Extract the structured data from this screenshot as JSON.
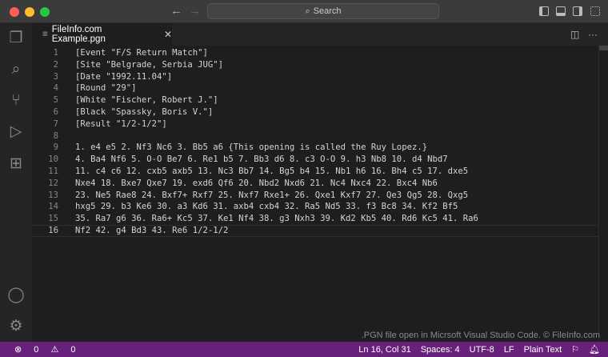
{
  "titlebar": {
    "search_label": "Search",
    "back_icon": "arrow-left",
    "forward_icon": "arrow-right"
  },
  "tab": {
    "title": "FileInfo.com Example.pgn"
  },
  "editor": {
    "lines": [
      "[Event \"F/S Return Match\"]",
      "[Site \"Belgrade, Serbia JUG\"]",
      "[Date \"1992.11.04\"]",
      "[Round \"29\"]",
      "[White \"Fischer, Robert J.\"]",
      "[Black \"Spassky, Boris V.\"]",
      "[Result \"1/2-1/2\"]",
      "",
      "1. e4 e5 2. Nf3 Nc6 3. Bb5 a6 {This opening is called the Ruy Lopez.}",
      "4. Ba4 Nf6 5. O-O Be7 6. Re1 b5 7. Bb3 d6 8. c3 O-O 9. h3 Nb8 10. d4 Nbd7",
      "11. c4 c6 12. cxb5 axb5 13. Nc3 Bb7 14. Bg5 b4 15. Nb1 h6 16. Bh4 c5 17. dxe5",
      "Nxe4 18. Bxe7 Qxe7 19. exd6 Qf6 20. Nbd2 Nxd6 21. Nc4 Nxc4 22. Bxc4 Nb6",
      "23. Ne5 Rae8 24. Bxf7+ Rxf7 25. Nxf7 Rxe1+ 26. Qxe1 Kxf7 27. Qe3 Qg5 28. Qxg5",
      "hxg5 29. b3 Ke6 30. a3 Kd6 31. axb4 cxb4 32. Ra5 Nd5 33. f3 Bc8 34. Kf2 Bf5",
      "35. Ra7 g6 36. Ra6+ Kc5 37. Ke1 Nf4 38. g3 Nxh3 39. Kd2 Kb5 40. Rd6 Kc5 41. Ra6",
      "Nf2 42. g4 Bd3 43. Re6 1/2-1/2"
    ],
    "current_line": 16
  },
  "watermark": ".PGN file open in Micrsoft Visual Studio Code. © FileInfo.com",
  "status": {
    "errors": "0",
    "warnings": "0",
    "position": "Ln 16, Col 31",
    "spaces": "Spaces: 4",
    "encoding": "UTF-8",
    "eol": "LF",
    "language": "Plain Text"
  },
  "colors": {
    "statusbar": "#68217a",
    "editor_bg": "#1e1e1e",
    "close": "#ff5f57",
    "minimize": "#febc2e",
    "maximize": "#28c840"
  }
}
